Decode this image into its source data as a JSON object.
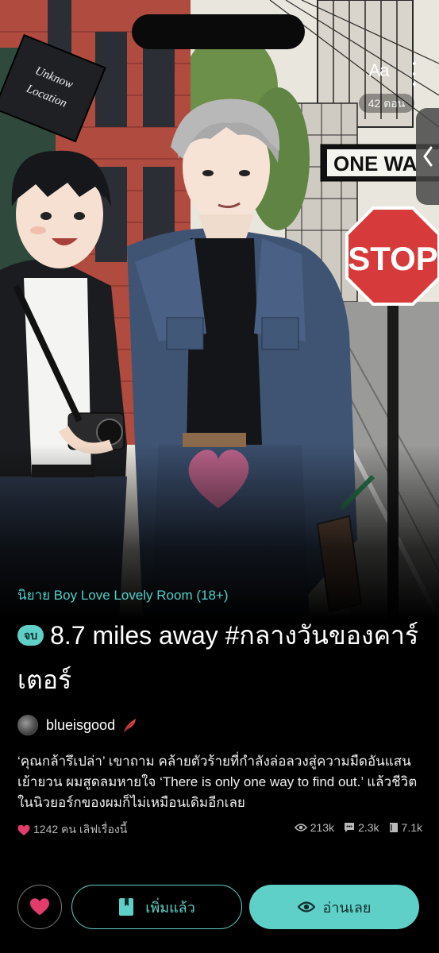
{
  "cover": {
    "sign_location": "Unknow Location",
    "sign_oneway": "ONE WA",
    "sign_stop": "STOP"
  },
  "header": {
    "font_label": "Aa",
    "episode_count": "42 ตอน"
  },
  "book": {
    "category": "นิยาย Boy Love Lovely Room (18+)",
    "status_badge": "จบ",
    "title": "8.7 miles away #กลางวันของคาร์เตอร์",
    "author": "blueisgood",
    "synopsis": "‘คุณกล้ารึเปล่า’ เขาถาม คล้ายตัวร้ายที่กำลังล่อลวงสู่ความมืดอันแสนเย้ายวน ผมสูดลมหายใจ ‘There is only one way to find out.’ แล้วชีวิตในนิวยอร์กของผมก็ไม่เหมือนเดิมอีกเลย"
  },
  "stats": {
    "likes_text": "1242 คน เลิฟเรื่องนี้",
    "views": "213k",
    "comments": "2.3k",
    "chapters": "7.1k"
  },
  "actions": {
    "library_label": "เพิ่มแล้ว",
    "read_label": "อ่านเลย"
  },
  "colors": {
    "accent": "#5fd0c8",
    "heart": "#e23c6c"
  }
}
